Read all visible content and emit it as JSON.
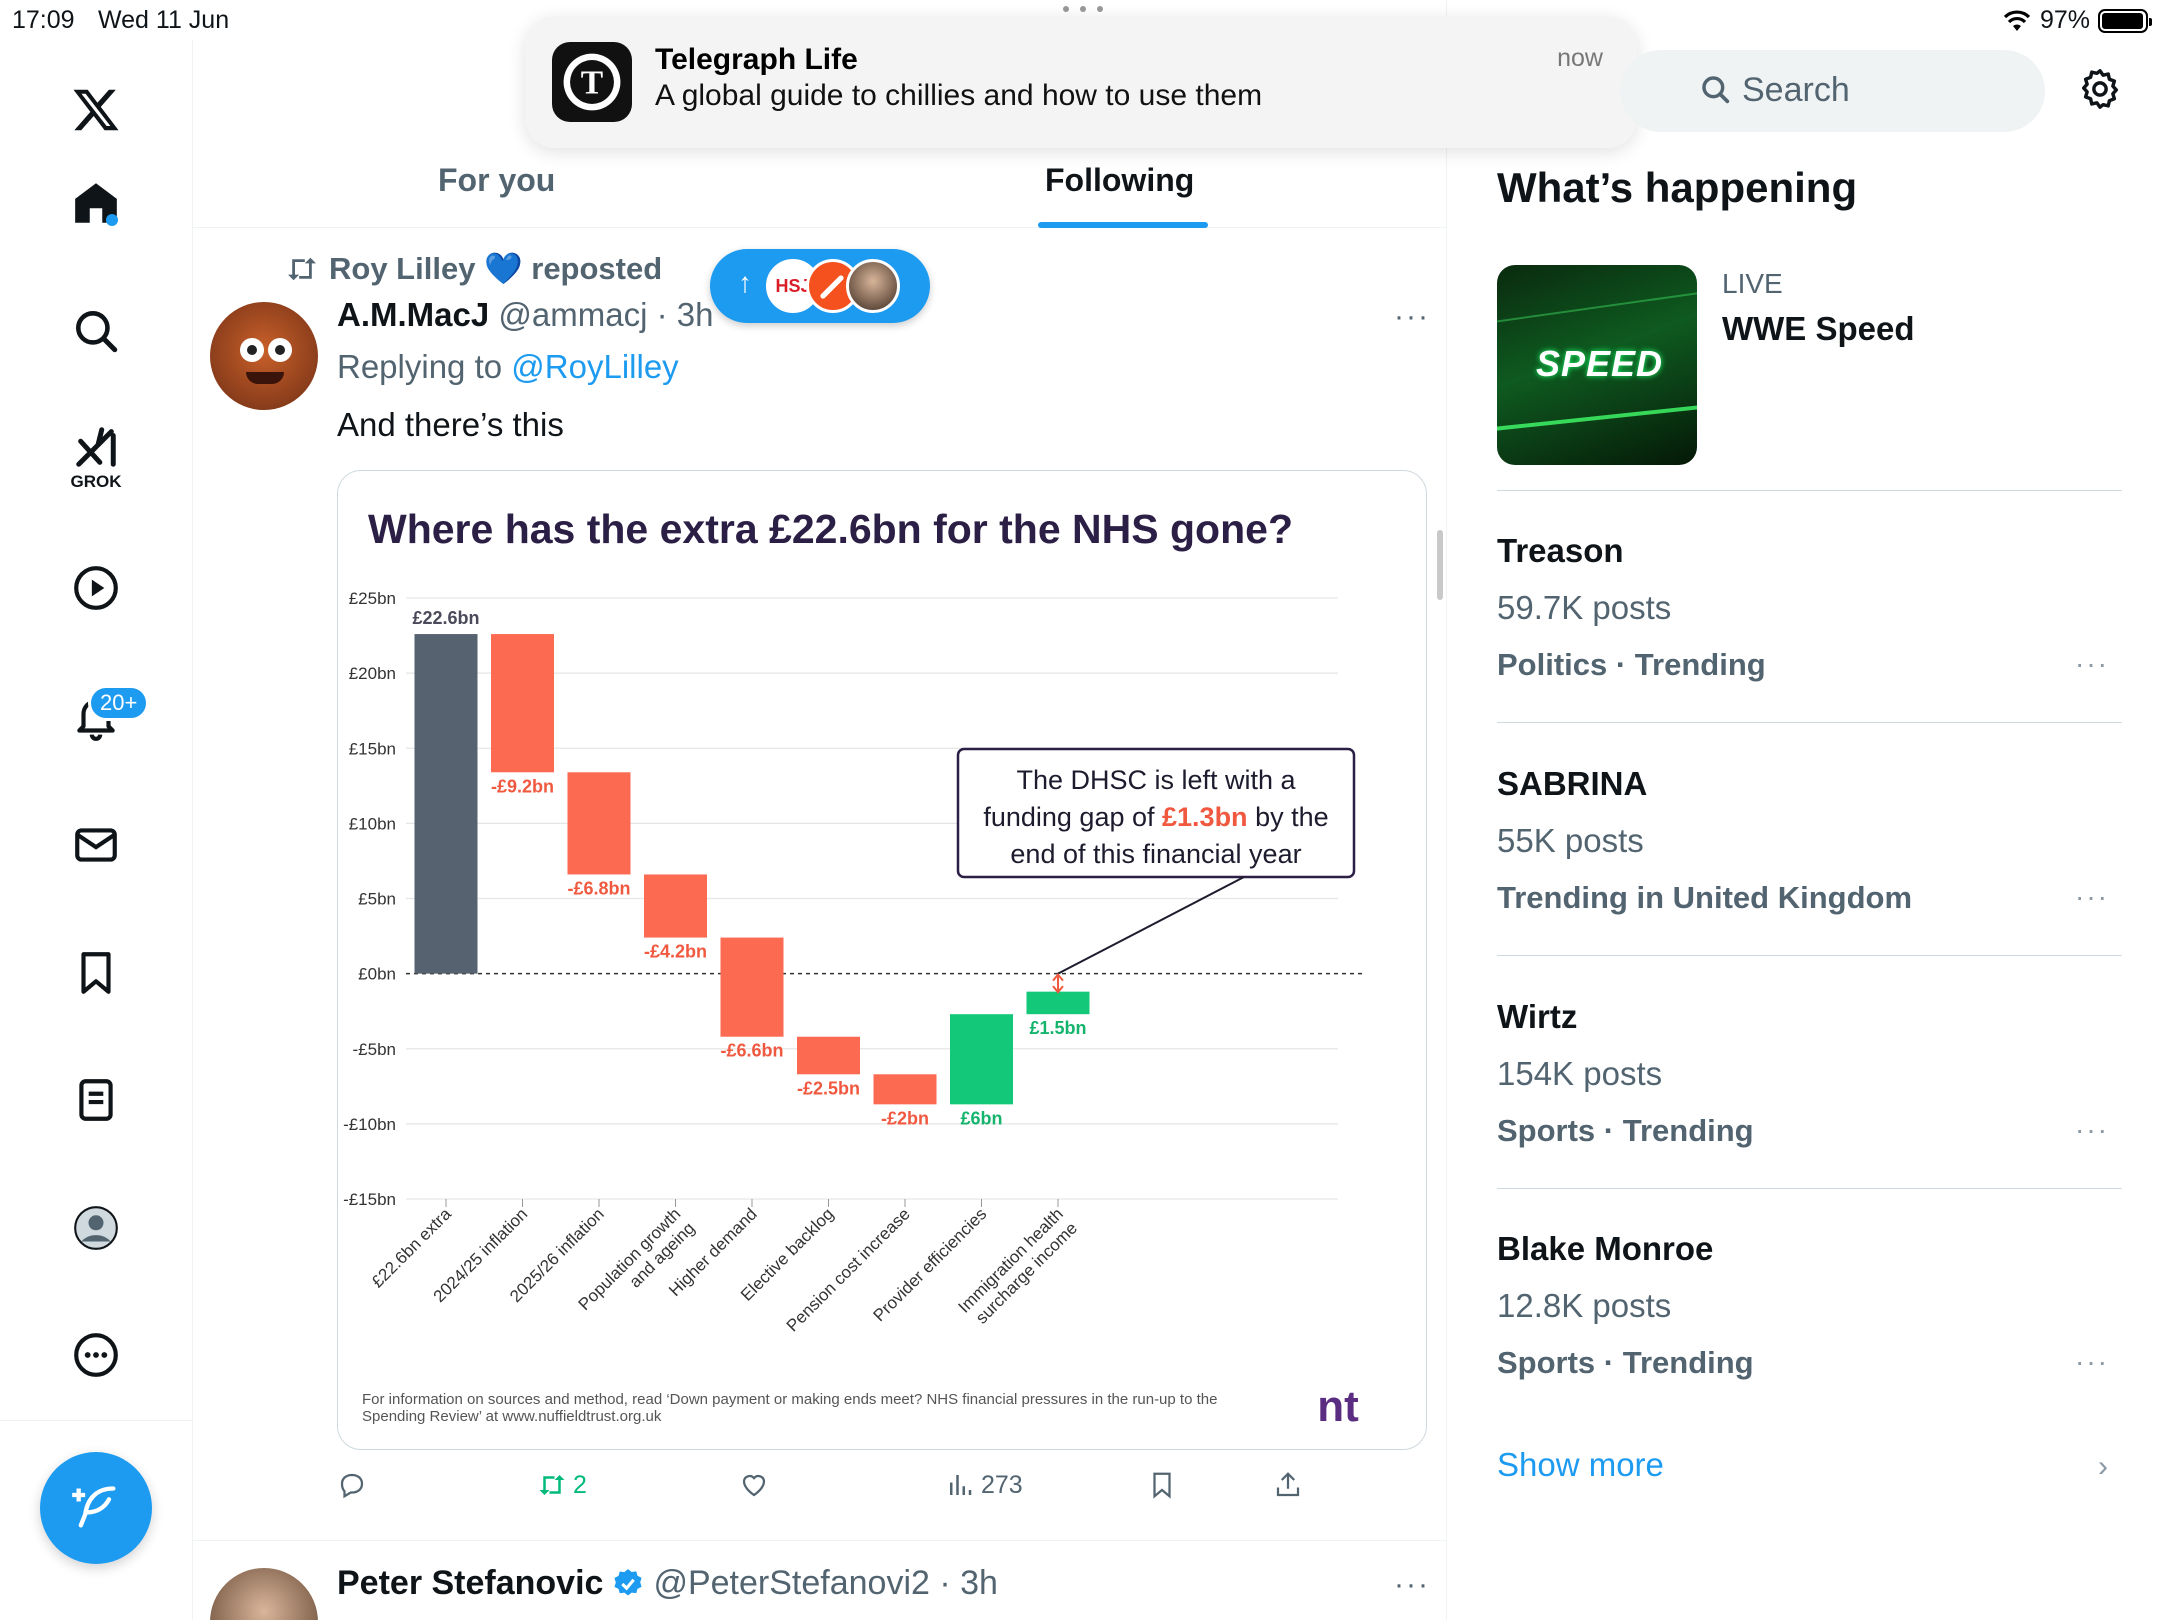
{
  "status_bar": {
    "time": "17:09",
    "date": "Wed 11 Jun",
    "battery": "97%",
    "battery_level": 0.97
  },
  "nav": {
    "logo": "x-logo-icon",
    "items": [
      "home-icon",
      "search-icon",
      "grok-icon",
      "video-icon",
      "bell-icon",
      "mail-icon",
      "bookmark-icon",
      "list-icon",
      "profile-icon",
      "more-circle-icon"
    ],
    "grok_label": "GROK",
    "notifications_badge": "20+"
  },
  "tabs": {
    "for_you": "For you",
    "following": "Following"
  },
  "notification": {
    "app": "Telegraph Life",
    "body": "A global guide to chillies and how to use them",
    "time": "now"
  },
  "post": {
    "repost_by": "Roy Lilley 💙 reposted",
    "author_name": "A.M.MacJ",
    "author_handle": "@ammacj · 3h",
    "replying_prefix": "Replying to",
    "replying_to": "@RoyLilley",
    "text": "And there’s this",
    "more": "···",
    "pill_badge": "HSJ",
    "pill_arrow": "↑",
    "actions": {
      "replies": "",
      "reposts": "2",
      "likes": "",
      "views": "273"
    }
  },
  "chart_data": {
    "type": "bar",
    "subtype": "waterfall",
    "title": "Where has the extra £22.6bn for the NHS gone?",
    "categories": [
      "£22.6bn extra",
      "2024/25 inflation",
      "2025/26 inflation",
      "Population growth and ageing",
      "Higher demand",
      "Elective backlog",
      "Pension cost increase",
      "Provider efficiencies",
      "Immigration health surcharge income"
    ],
    "values": [
      22.6,
      -9.2,
      -6.8,
      -4.2,
      -6.6,
      -2.5,
      -2.0,
      6.0,
      1.5
    ],
    "value_labels": [
      "£22.6bn",
      "-£9.2bn",
      "-£6.8bn",
      "-£4.2bn",
      "-£6.6bn",
      "-£2.5bn",
      "-£2bn",
      "£6bn",
      "£1.5bn"
    ],
    "bar_colors": [
      "#56626f",
      "#fd6a52",
      "#fd6a52",
      "#fd6a52",
      "#fd6a52",
      "#fd6a52",
      "#fd6a52",
      "#13c878",
      "#13c878"
    ],
    "label_colors": [
      "#4a4a5a",
      "#f0583f",
      "#f0583f",
      "#f0583f",
      "#f0583f",
      "#f0583f",
      "#f0583f",
      "#14b46c",
      "#14b46c"
    ],
    "yticks": [
      "£25bn",
      "£20bn",
      "£15bn",
      "£10bn",
      "£5bn",
      "£0bn",
      "-£5bn",
      "-£10bn",
      "-£15bn"
    ],
    "ytick_values": [
      25,
      20,
      15,
      10,
      5,
      0,
      -5,
      -10,
      -15
    ],
    "ylim": [
      -15,
      25
    ],
    "xlabel": "",
    "ylabel": "",
    "grid": true,
    "zero_line": "dashed",
    "annotation": {
      "line1": "The DHSC is left with a",
      "line2_pre": "funding gap of",
      "line2_value": "£1.3bn",
      "line2_post": "by the",
      "line3": "end of this financial year",
      "gap_value": -1.3
    },
    "footer": "For information on sources and method, read ‘Down payment or making ends meet? NHS financial pressures in the run-up to the Spending Review’ at www.nuffieldtrust.org.uk",
    "source_logo": "nt",
    "title_color": "#2b1f45",
    "logo_color": "#5b2d82"
  },
  "post2": {
    "author_name": "Peter Stefanovic",
    "author_handle": "@PeterStefanovi2 · 3h",
    "more": "···"
  },
  "sidebar": {
    "search_placeholder": "Search",
    "heading": "What’s happening",
    "live": {
      "label": "LIVE",
      "title": "WWE Speed",
      "thumb_text": "SPEED"
    },
    "trends": [
      {
        "name": "Treason",
        "count": "59.7K posts",
        "category": "Politics · Trending"
      },
      {
        "name": "SABRINA",
        "count": "55K posts",
        "category": "Trending in United Kingdom"
      },
      {
        "name": "Wirtz",
        "count": "154K posts",
        "category": "Sports · Trending"
      },
      {
        "name": "Blake Monroe",
        "count": "12.8K posts",
        "category": "Sports · Trending"
      }
    ],
    "trend_more": "···",
    "show_more": "Show more",
    "show_more_chevron": "›"
  },
  "colors": {
    "accent": "#1d9bf0",
    "text": "#0f1419",
    "muted": "#536471",
    "green_retweet": "#00ba7c"
  }
}
